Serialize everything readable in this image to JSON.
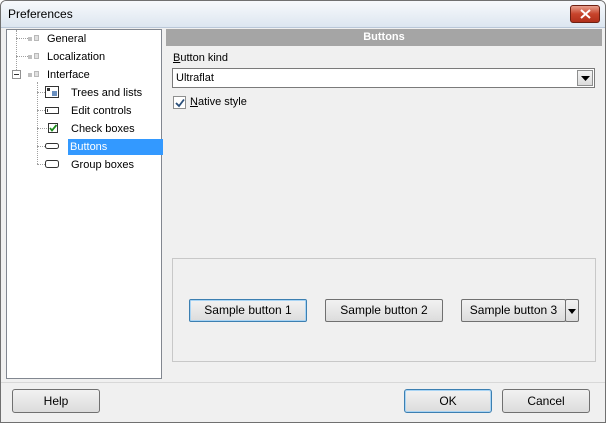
{
  "window": {
    "title": "Preferences"
  },
  "tree": {
    "items": [
      {
        "label": "General",
        "icon": "options-icon",
        "level": 0
      },
      {
        "label": "Localization",
        "icon": "options-icon",
        "level": 0
      },
      {
        "label": "Interface",
        "icon": "options-icon",
        "level": 0,
        "expanded": true
      },
      {
        "label": "Trees and lists",
        "icon": "tree-list-icon",
        "level": 1
      },
      {
        "label": "Edit controls",
        "icon": "edit-control-icon",
        "level": 1
      },
      {
        "label": "Check boxes",
        "icon": "checkbox-icon",
        "level": 1
      },
      {
        "label": "Buttons",
        "icon": "button-icon",
        "level": 1,
        "selected": true
      },
      {
        "label": "Group boxes",
        "icon": "group-box-icon",
        "level": 1
      }
    ]
  },
  "panel": {
    "header": "Buttons",
    "button_kind_label_accel": "B",
    "button_kind_label_rest": "utton kind",
    "button_kind_value": "Ultraflat",
    "native_style_accel": "N",
    "native_style_rest": "ative style",
    "native_style_checked": true,
    "samples": [
      "Sample button 1",
      "Sample button 2",
      "Sample button 3"
    ]
  },
  "footer": {
    "help": "Help",
    "ok": "OK",
    "cancel": "Cancel"
  },
  "colors": {
    "selection": "#3399ff",
    "header_bg": "#a5a5a5",
    "close": "#c7432b"
  }
}
